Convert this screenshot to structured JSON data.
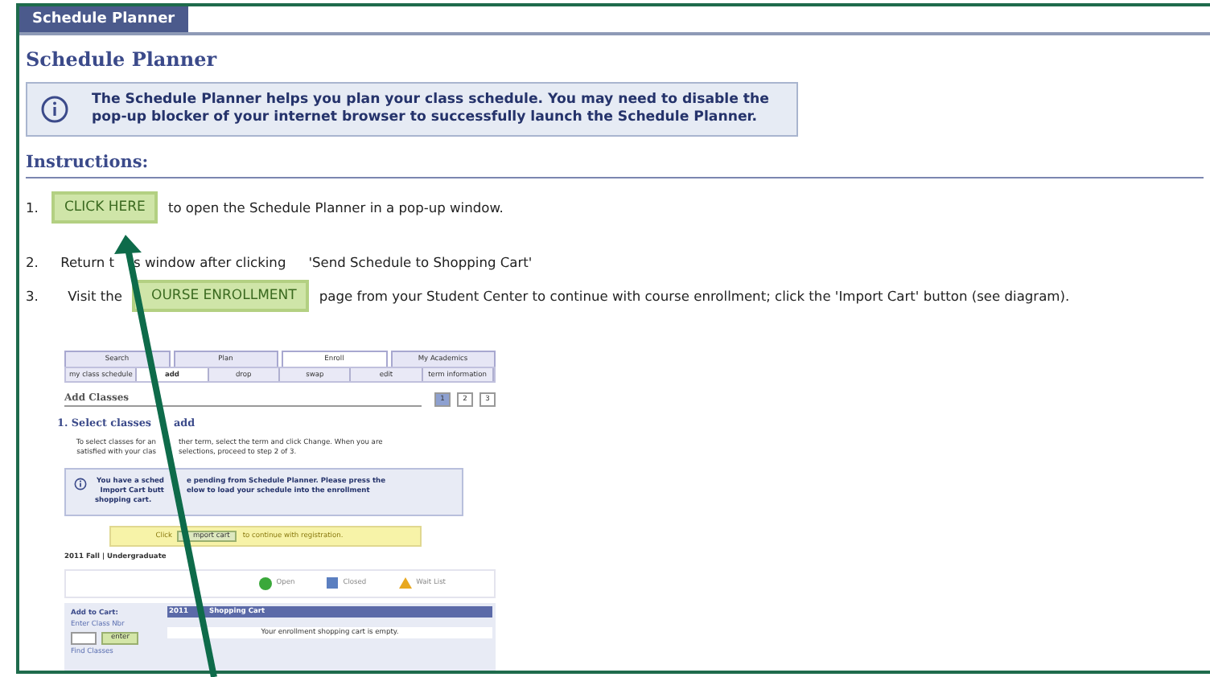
{
  "tab": {
    "label": "Schedule Planner",
    "selected": true
  },
  "title": "Schedule Planner",
  "info": "The Schedule Planner helps you plan your class schedule. You may need to disable the pop-up blocker of your internet browser to successfully launch the Schedule Planner.",
  "instructions_heading": "Instructions:",
  "steps": [
    {
      "kind": "button",
      "number": "1.",
      "button": "CLICK HERE",
      "text": "to open the Schedule Planner in a pop-up window."
    },
    {
      "kind": "split",
      "number": "2.",
      "text": "Return t",
      "text_after": "s window after clicking",
      "quote": "'Send Schedule to Shopping Cart'"
    },
    {
      "kind": "lead",
      "number": "3.",
      "before": "Visit the",
      "button": "OURSE ENROLLMENT",
      "text": "page from your Student Center to continue with course enrollment; click the 'Import Cart' button (see diagram)."
    }
  ],
  "diagram": {
    "tabs": [
      {
        "label": "Search",
        "selected": false
      },
      {
        "label": "Plan",
        "selected": false
      },
      {
        "label": "Enroll",
        "selected": true
      },
      {
        "label": "My Academics",
        "selected": false
      }
    ],
    "subtabs": [
      {
        "label": "my class schedule",
        "selected": false
      },
      {
        "label": "add",
        "selected": true
      },
      {
        "label": "drop",
        "selected": false
      },
      {
        "label": "swap",
        "selected": false
      },
      {
        "label": "edit",
        "selected": false
      },
      {
        "label": "term information",
        "selected": false
      }
    ],
    "section_title": "Add Classes",
    "progress": [
      {
        "label": "1",
        "selected": true
      },
      {
        "label": "2",
        "selected": false
      },
      {
        "label": "3",
        "selected": false
      }
    ],
    "step_heading": {
      "before": "1.  Select classes",
      "after": "add"
    },
    "instruction": [
      {
        "before": "To select classes for an",
        "after": "ther term, select the term and click Change.  When you are"
      },
      {
        "before": "satisfied with your clas",
        "after": "selections, proceed to step 2 of 3."
      }
    ],
    "notice": [
      {
        "before": "You have a sched",
        "after": "e pending from Schedule Planner.  Please press the"
      },
      {
        "before": "Import Cart butt",
        "after": "elow to load your schedule into the enrollment"
      },
      {
        "before": "shopping cart."
      }
    ],
    "import_bar": {
      "before": "Click",
      "button": "mport cart",
      "after": "to continue with registration."
    },
    "term": "2011 Fall | Undergraduate",
    "legend": [
      {
        "kind": "open",
        "label": "Open"
      },
      {
        "kind": "closed",
        "label": "Closed"
      },
      {
        "kind": "wait",
        "label": "Wait List"
      }
    ],
    "add_panel": {
      "title": "Add to Cart:",
      "field_label": "Enter Class Nbr",
      "button": "enter",
      "link": "Find Classes"
    },
    "cart": {
      "title_before": "2011",
      "title_after": "Shopping Cart",
      "message": "Your enrollment shopping cart is empty."
    }
  }
}
